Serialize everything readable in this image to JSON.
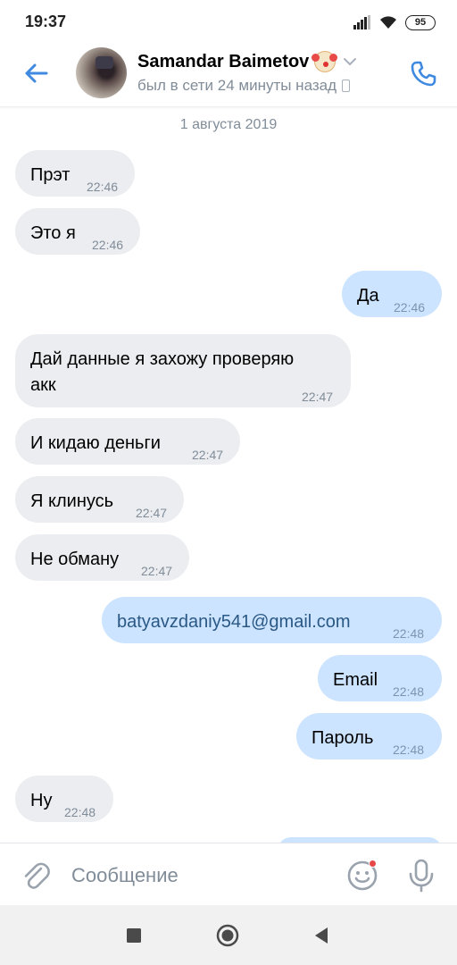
{
  "status_bar": {
    "time": "19:37",
    "battery": "95"
  },
  "header": {
    "contact_name": "Samandar Baimetov",
    "status": "был в сети 24 минуты назад"
  },
  "date_separator": "1 августа 2019",
  "messages": [
    {
      "direction": "in",
      "lines": [
        "Прэт"
      ],
      "time": "22:46"
    },
    {
      "direction": "in",
      "lines": [
        "Это я"
      ],
      "time": "22:46"
    },
    {
      "direction": "out",
      "lines": [
        "Да"
      ],
      "time": "22:46"
    },
    {
      "direction": "in",
      "lines": [
        "Дай данные я захожу проверяю",
        "акк"
      ],
      "time": "22:47"
    },
    {
      "direction": "in",
      "lines": [
        "И кидаю деньги"
      ],
      "time": "22:47"
    },
    {
      "direction": "in",
      "lines": [
        "Я клинусь"
      ],
      "time": "22:47"
    },
    {
      "direction": "in",
      "lines": [
        "Не обману"
      ],
      "time": "22:47"
    },
    {
      "direction": "out",
      "lines": [
        "batyavzdaniy541@gmail.com"
      ],
      "time": "22:48"
    },
    {
      "direction": "out",
      "lines": [
        "Email"
      ],
      "time": "22:48"
    },
    {
      "direction": "out",
      "lines": [
        "Пароль"
      ],
      "time": "22:48"
    },
    {
      "direction": "in",
      "lines": [
        "Ну"
      ],
      "time": "22:48"
    }
  ],
  "composer": {
    "placeholder": "Сообщение"
  },
  "colors": {
    "accent": "#3f8ae0",
    "incoming_bubble": "#ebedf0",
    "outgoing_bubble": "#cce4ff",
    "link": "#2a5885",
    "notification_dot": "#e64646"
  },
  "icons": [
    "back-arrow-icon",
    "clown-emoji-icon",
    "chevron-down-icon",
    "phone-icon",
    "attach-icon",
    "emoji-icon",
    "mic-icon",
    "nav-recents-icon",
    "nav-home-icon",
    "nav-back-icon"
  ]
}
